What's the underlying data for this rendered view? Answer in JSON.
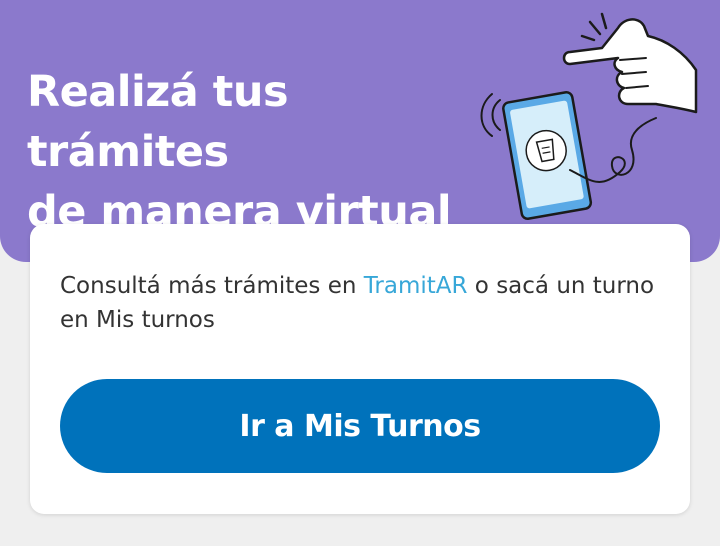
{
  "banner": {
    "headline_line1": "Realizá tus trámites",
    "headline_line2": "de manera virtual",
    "background_color": "#8b79cc",
    "illustration": "hand-pointing-at-phone-illustration"
  },
  "card": {
    "text_before": "Consultá más trámites en ",
    "link_label": "TramitAR",
    "text_after": " o sacá un turno en Mis turnos",
    "link_color": "#37a7d8"
  },
  "cta": {
    "label": "Ir a Mis Turnos",
    "color": "#0072bb"
  }
}
